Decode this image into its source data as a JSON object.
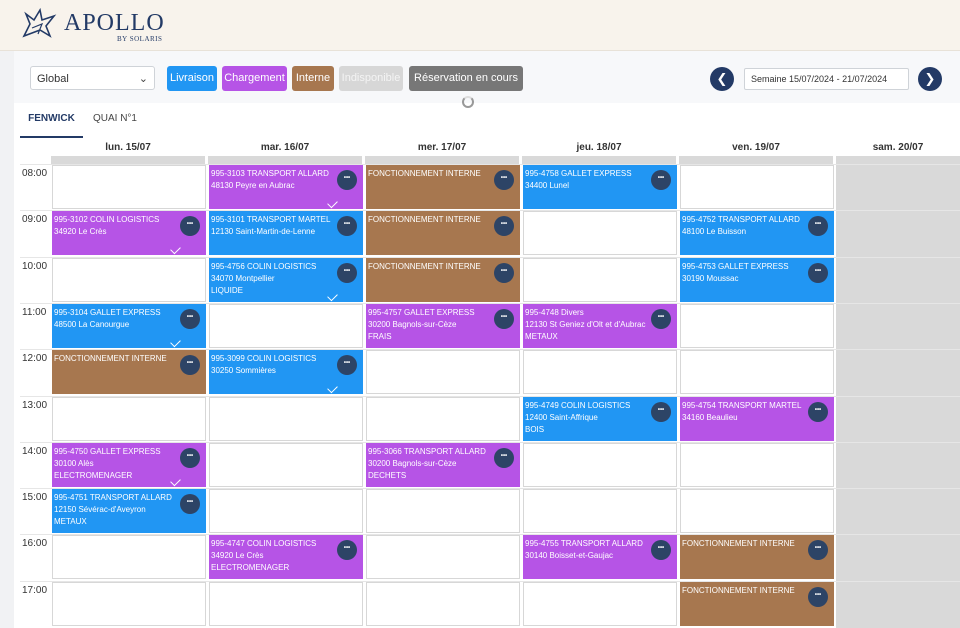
{
  "brand": {
    "name": "APOLLO",
    "sub": "BY SOLARIS",
    "logo_icon": "griffin-icon"
  },
  "toolbar": {
    "filter_value": "Global",
    "legend": [
      {
        "label": "Livraison",
        "color": "#2196f3"
      },
      {
        "label": "Chargement",
        "color": "#b654e6"
      },
      {
        "label": "Interne",
        "color": "#a7774f"
      },
      {
        "label": "Indisponible",
        "color": "#d7d7d7"
      },
      {
        "label": "Réservation en cours",
        "color": "#777777"
      }
    ],
    "week_label": "Semaine 15/07/2024 - 21/07/2024",
    "prev_icon": "chevron-left-icon",
    "next_icon": "chevron-right-icon"
  },
  "tabs": [
    "FENWICK",
    "QUAI N°1"
  ],
  "days": [
    "lun. 15/07",
    "mar. 16/07",
    "mer. 17/07",
    "jeu. 18/07",
    "ven. 19/07",
    "sam. 20/07"
  ],
  "hours": [
    "08:00",
    "09:00",
    "10:00",
    "11:00",
    "12:00",
    "13:00",
    "14:00",
    "15:00",
    "16:00",
    "17:00"
  ],
  "events": [
    {
      "day": 1,
      "hour": 0,
      "type": "charg",
      "lines": [
        "995-3103 TRANSPORT ALLARD",
        "48130 Peyre en Aubrac"
      ],
      "check": true
    },
    {
      "day": 2,
      "hour": 0,
      "type": "int",
      "lines": [
        "FONCTIONNEMENT INTERNE"
      ],
      "check": false
    },
    {
      "day": 3,
      "hour": 0,
      "type": "liv",
      "lines": [
        "995-4758 GALLET EXPRESS",
        "34400 Lunel"
      ],
      "check": false
    },
    {
      "day": 0,
      "hour": 1,
      "type": "charg",
      "lines": [
        "995-3102 COLIN LOGISTICS",
        "34920 Le Crès"
      ],
      "check": true
    },
    {
      "day": 1,
      "hour": 1,
      "type": "liv",
      "lines": [
        "995-3101 TRANSPORT MARTEL",
        "12130 Saint-Martin-de-Lenne"
      ],
      "check": false
    },
    {
      "day": 2,
      "hour": 1,
      "type": "int",
      "lines": [
        "FONCTIONNEMENT INTERNE"
      ],
      "check": false
    },
    {
      "day": 4,
      "hour": 1,
      "type": "liv",
      "lines": [
        "995-4752 TRANSPORT ALLARD",
        "48100 Le Buisson"
      ],
      "check": false
    },
    {
      "day": 1,
      "hour": 2,
      "type": "liv",
      "lines": [
        "995-4756 COLIN LOGISTICS",
        "34070 Montpellier",
        "LIQUIDE"
      ],
      "check": true
    },
    {
      "day": 2,
      "hour": 2,
      "type": "int",
      "lines": [
        "FONCTIONNEMENT INTERNE"
      ],
      "check": false
    },
    {
      "day": 4,
      "hour": 2,
      "type": "liv",
      "lines": [
        "995-4753 GALLET EXPRESS",
        "30190 Moussac"
      ],
      "check": false
    },
    {
      "day": 0,
      "hour": 3,
      "type": "liv",
      "lines": [
        "995-3104 GALLET EXPRESS",
        "48500 La Canourgue"
      ],
      "check": true
    },
    {
      "day": 2,
      "hour": 3,
      "type": "charg",
      "lines": [
        "995-4757 GALLET EXPRESS",
        "30200 Bagnols-sur-Cèze",
        "FRAIS"
      ],
      "check": false
    },
    {
      "day": 3,
      "hour": 3,
      "type": "charg",
      "lines": [
        "995-4748 Divers",
        "12130 St Geniez d'Olt et d'Aubrac",
        "METAUX"
      ],
      "check": false
    },
    {
      "day": 0,
      "hour": 4,
      "type": "int",
      "lines": [
        "FONCTIONNEMENT INTERNE"
      ],
      "check": false
    },
    {
      "day": 1,
      "hour": 4,
      "type": "liv",
      "lines": [
        "995-3099 COLIN LOGISTICS",
        "30250 Sommières"
      ],
      "check": true
    },
    {
      "day": 3,
      "hour": 5,
      "type": "liv",
      "lines": [
        "995-4749 COLIN LOGISTICS",
        "12400 Saint-Affrique",
        "BOIS"
      ],
      "check": false
    },
    {
      "day": 4,
      "hour": 5,
      "type": "charg",
      "lines": [
        "995-4754 TRANSPORT MARTEL",
        "34160 Beaulieu"
      ],
      "check": false
    },
    {
      "day": 0,
      "hour": 6,
      "type": "charg",
      "lines": [
        "995-4750 GALLET EXPRESS",
        "30100 Alès",
        "ELECTROMENAGER"
      ],
      "check": true
    },
    {
      "day": 2,
      "hour": 6,
      "type": "charg",
      "lines": [
        "995-3066 TRANSPORT ALLARD",
        "30200 Bagnols-sur-Cèze",
        "DECHETS"
      ],
      "check": false
    },
    {
      "day": 0,
      "hour": 7,
      "type": "liv",
      "lines": [
        "995-4751 TRANSPORT ALLARD",
        "12150 Sévérac-d'Aveyron",
        "METAUX"
      ],
      "check": false
    },
    {
      "day": 1,
      "hour": 8,
      "type": "charg",
      "lines": [
        "995-4747 COLIN LOGISTICS",
        "34920 Le Crès",
        "ELECTROMENAGER"
      ],
      "check": false
    },
    {
      "day": 3,
      "hour": 8,
      "type": "charg",
      "lines": [
        "995-4755 TRANSPORT ALLARD",
        "30140 Boisset-et-Gaujac"
      ],
      "check": false
    },
    {
      "day": 4,
      "hour": 8,
      "type": "int",
      "lines": [
        "FONCTIONNEMENT INTERNE"
      ],
      "check": false
    },
    {
      "day": 4,
      "hour": 9,
      "type": "int",
      "lines": [
        "FONCTIONNEMENT INTERNE"
      ],
      "check": false
    }
  ]
}
